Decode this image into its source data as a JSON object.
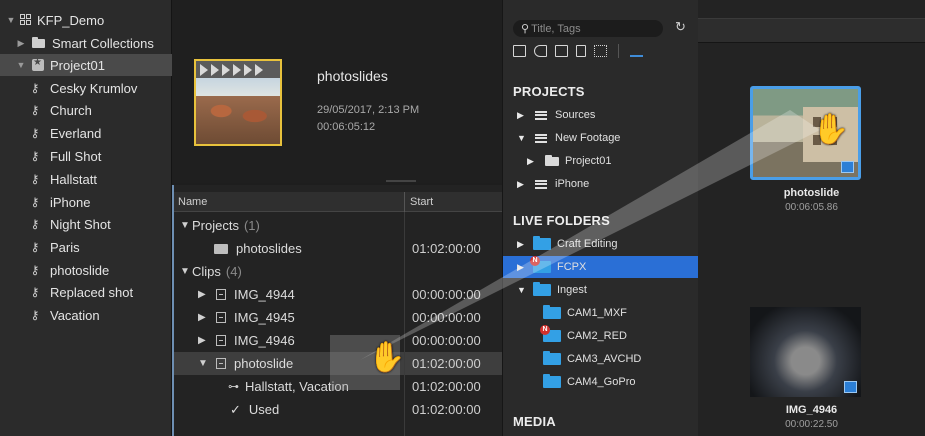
{
  "sidebar": {
    "items": [
      {
        "label": "KFP_Demo",
        "kind": "library"
      },
      {
        "label": "Smart Collections",
        "kind": "folder"
      },
      {
        "label": "Project01",
        "kind": "event"
      },
      {
        "label": "Cesky Krumlov",
        "kind": "keyword"
      },
      {
        "label": "Church",
        "kind": "keyword"
      },
      {
        "label": "Everland",
        "kind": "keyword"
      },
      {
        "label": "Full Shot",
        "kind": "keyword"
      },
      {
        "label": "Hallstatt",
        "kind": "keyword"
      },
      {
        "label": "iPhone",
        "kind": "keyword"
      },
      {
        "label": "Night Shot",
        "kind": "keyword"
      },
      {
        "label": "Paris",
        "kind": "keyword"
      },
      {
        "label": "photoslide",
        "kind": "keyword"
      },
      {
        "label": "Replaced shot",
        "kind": "keyword"
      },
      {
        "label": "Vacation",
        "kind": "keyword"
      }
    ]
  },
  "project_header": {
    "title": "photoslides",
    "date": "29/05/2017, 2:13 PM",
    "duration": "00:06:05:12"
  },
  "list": {
    "col_name": "Name",
    "col_start": "Start",
    "rows": [
      {
        "label": "Projects",
        "count": "(1)",
        "start": ""
      },
      {
        "label": "photoslides",
        "count": "",
        "start": "01:02:00:00"
      },
      {
        "label": "Clips",
        "count": "(4)",
        "start": ""
      },
      {
        "label": "IMG_4944",
        "count": "",
        "start": "00:00:00:00"
      },
      {
        "label": "IMG_4945",
        "count": "",
        "start": "00:00:00:00"
      },
      {
        "label": "IMG_4946",
        "count": "",
        "start": "00:00:00:00"
      },
      {
        "label": "photoslide",
        "count": "",
        "start": "01:02:00:00"
      },
      {
        "label": "Hallstatt, Vacation",
        "count": "",
        "start": "01:02:00:00"
      },
      {
        "label": "Used",
        "count": "",
        "start": "01:02:00:00"
      }
    ]
  },
  "browser": {
    "search_placeholder": "Title, Tags",
    "projects_heading": "PROJECTS",
    "projects": [
      {
        "label": "Sources"
      },
      {
        "label": "New Footage"
      },
      {
        "label": "Project01"
      },
      {
        "label": "iPhone"
      }
    ],
    "live_heading": "LIVE FOLDERS",
    "live": [
      {
        "label": "Craft Editing"
      },
      {
        "label": "FCPX"
      },
      {
        "label": "Ingest"
      },
      {
        "label": "CAM1_MXF"
      },
      {
        "label": "CAM2_RED"
      },
      {
        "label": "CAM3_AVCHD"
      },
      {
        "label": "CAM4_GoPro"
      }
    ],
    "media_heading": "MEDIA"
  },
  "viewer": {
    "clips": [
      {
        "title": "photoslide",
        "duration": "00:06:05.86"
      },
      {
        "title": "IMG_4946",
        "duration": "00:00:22.50"
      }
    ]
  },
  "colors": {
    "selection_blue": "#2a6fd6",
    "folder_blue": "#33a0e5",
    "thumb_border": "#e8c23c",
    "focus_border": "#4a9ee8"
  }
}
